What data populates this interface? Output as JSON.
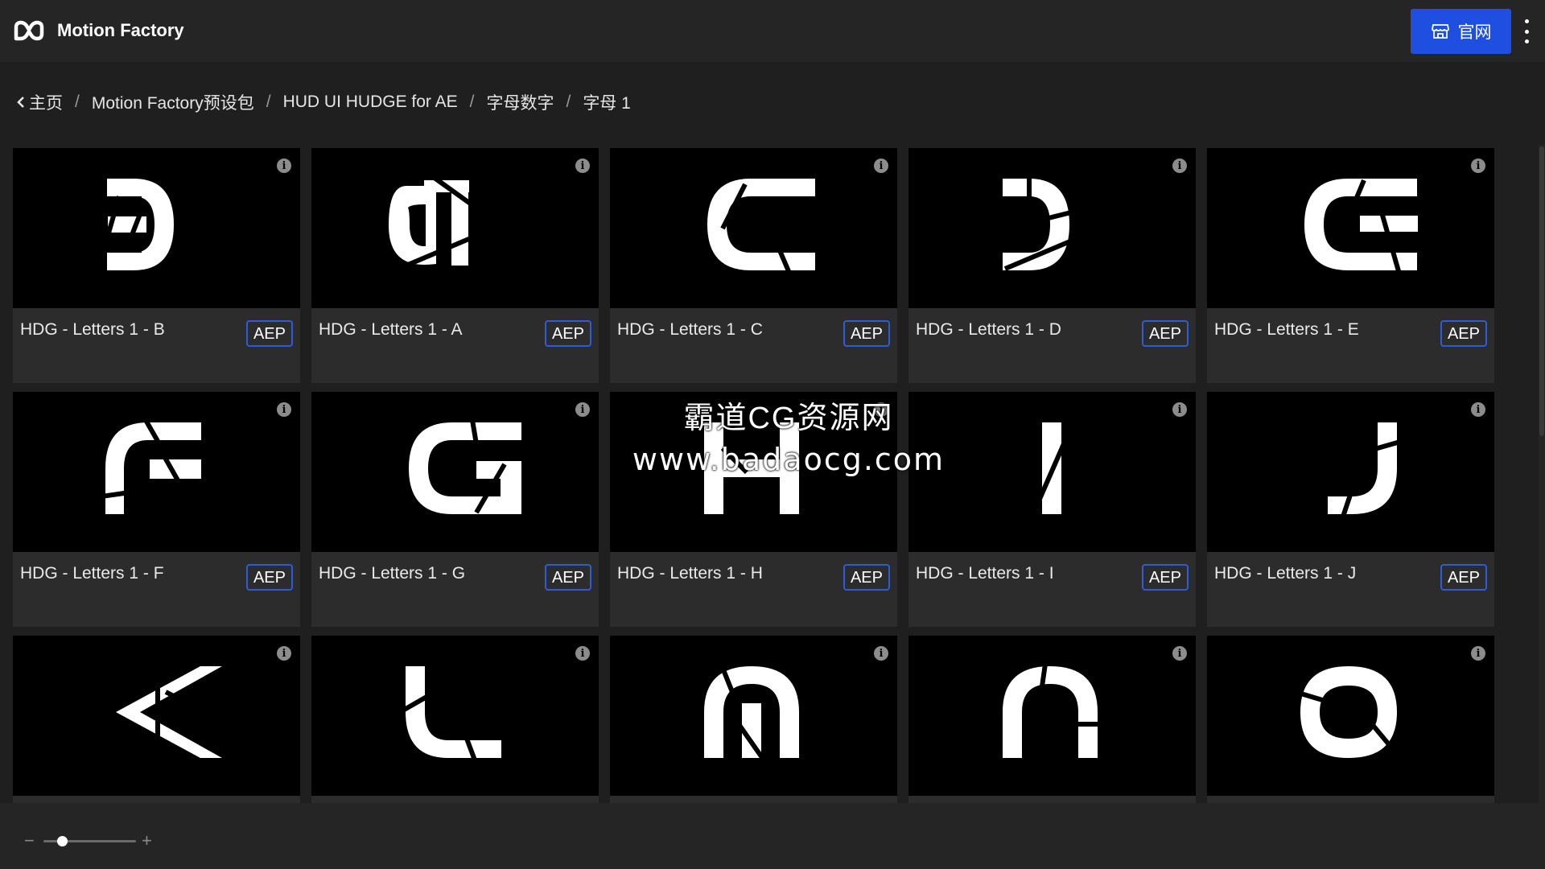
{
  "app": {
    "title": "Motion Factory"
  },
  "header": {
    "official_button_label": "官网"
  },
  "breadcrumb": [
    "主页",
    "Motion Factory预设包",
    "HUD UI HUDGE for AE",
    "字母数字",
    "字母 1"
  ],
  "cards": [
    {
      "title": "HDG - Letters 1 - B",
      "badge": "AEP",
      "letter": "B"
    },
    {
      "title": "HDG - Letters 1 - A",
      "badge": "AEP",
      "letter": "A"
    },
    {
      "title": "HDG - Letters 1 - C",
      "badge": "AEP",
      "letter": "C"
    },
    {
      "title": "HDG - Letters 1 - D",
      "badge": "AEP",
      "letter": "D"
    },
    {
      "title": "HDG - Letters 1 - E",
      "badge": "AEP",
      "letter": "E"
    },
    {
      "title": "HDG - Letters 1 - F",
      "badge": "AEP",
      "letter": "F"
    },
    {
      "title": "HDG - Letters 1 - G",
      "badge": "AEP",
      "letter": "G"
    },
    {
      "title": "HDG - Letters 1 - H",
      "badge": "AEP",
      "letter": "H"
    },
    {
      "title": "HDG - Letters 1 - I",
      "badge": "AEP",
      "letter": "I"
    },
    {
      "title": "HDG - Letters 1 - J",
      "badge": "AEP",
      "letter": "J"
    },
    {
      "title": "",
      "badge": "",
      "letter": "K"
    },
    {
      "title": "",
      "badge": "",
      "letter": "L"
    },
    {
      "title": "",
      "badge": "",
      "letter": "M"
    },
    {
      "title": "",
      "badge": "",
      "letter": "N"
    },
    {
      "title": "",
      "badge": "",
      "letter": "O"
    }
  ],
  "watermark": {
    "line1": "霸道CG资源网",
    "line2": "www.badaocg.com"
  },
  "zoom": {
    "minus": "−",
    "plus": "+",
    "level": 0.2
  },
  "colors": {
    "accent": "#1f4fe0",
    "badge_border": "#2f5bd8",
    "background": "#1f1f1f"
  },
  "icons": {
    "logo": "motion-factory-logo-icon",
    "store": "store-icon",
    "menu": "kebab-menu-icon",
    "back": "chevron-left-icon",
    "info": "info-icon"
  }
}
